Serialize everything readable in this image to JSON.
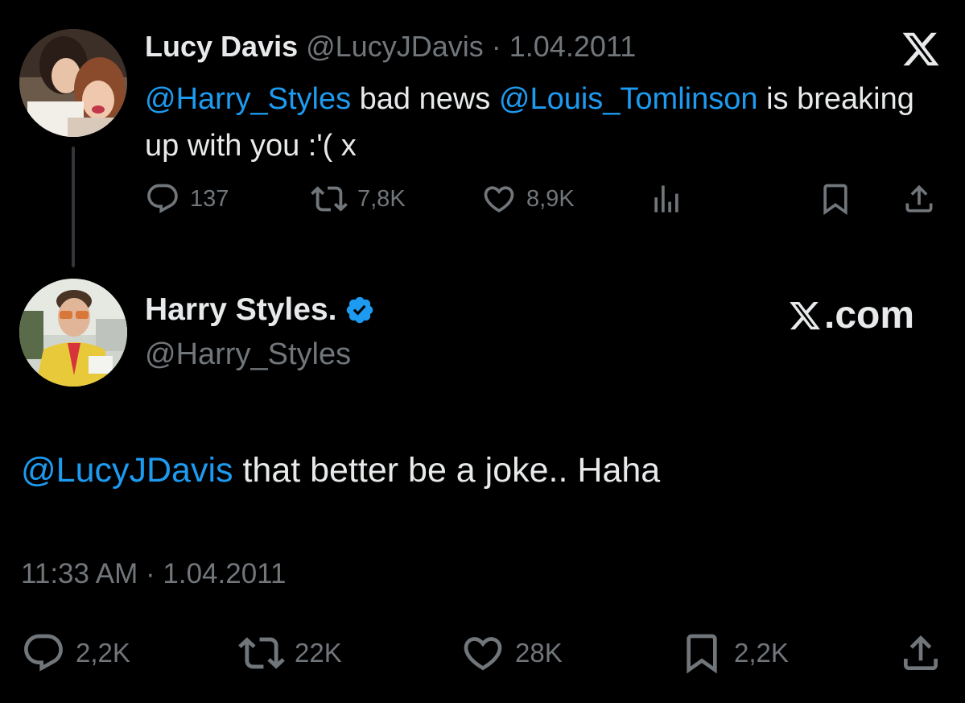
{
  "original_tweet": {
    "display_name": "Lucy Davis",
    "handle": "@LucyJDavis",
    "separator": "·",
    "date": "1.04.2011",
    "text_parts": [
      {
        "kind": "mention",
        "text": "@Harry_Styles"
      },
      {
        "kind": "text",
        "text": " bad news "
      },
      {
        "kind": "mention",
        "text": "@Louis_Tomlinson"
      },
      {
        "kind": "text",
        "text": " is breaking up with you :'( x"
      }
    ],
    "metrics": {
      "replies": "137",
      "retweets": "7,8K",
      "likes": "8,9K"
    },
    "icons": [
      "reply-icon",
      "retweet-icon",
      "like-icon",
      "views-icon",
      "bookmark-icon",
      "share-icon"
    ]
  },
  "reply_tweet": {
    "display_name": "Harry Styles.",
    "handle": "@Harry_Styles",
    "verified": true,
    "text_parts": [
      {
        "kind": "mention",
        "text": "@LucyJDavis"
      },
      {
        "kind": "text",
        "text": " that better be a joke.. Haha"
      }
    ],
    "time": "11:33 AM",
    "separator": "·",
    "date": "1.04.2011",
    "metrics": {
      "replies": "2,2K",
      "retweets": "22K",
      "likes": "28K",
      "bookmarks": "2,2K"
    }
  },
  "branding": {
    "x_logo": "x-logo-icon",
    "site_suffix": ".com"
  },
  "colors": {
    "background": "#000000",
    "text": "#e7e9ea",
    "muted": "#71767b",
    "mention": "#1d9bf0",
    "verified": "#1d9bf0"
  }
}
